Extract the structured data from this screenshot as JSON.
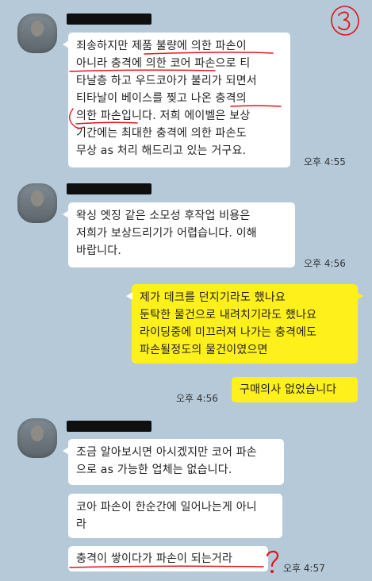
{
  "messages": [
    {
      "sender": "other",
      "lines": [
        "죄송하지만 제품 불량에 의한 파손이",
        "아니라 충격에 의한 코어 파손으로 티",
        "타날층 하고 우드코아가 불리가 되면서",
        " 티타날이 베이스를 찢고 나온 충격의",
        "의한 파손입니다. 저희 에이벨은 보상",
        "기간에는 최대한 충격에 의한 파손도",
        "무상 as 처리 해드리고 있는 거구요."
      ],
      "time": "오후 4:55"
    },
    {
      "sender": "other",
      "lines": [
        "왁싱 엣징 같은 소모성 후작업 비용은",
        "저희가 보상드리기가 어렵습니다. 이해",
        " 바랍니다."
      ],
      "time": "오후 4:56"
    },
    {
      "sender": "me",
      "lines": [
        "제가 데크를 던지기라도 했나요",
        "둔탁한 물건으로 내려치기라도 했나요",
        "라이딩중에 미끄러져 나가는 충격에도",
        "파손될정도의 물건이였으면"
      ]
    },
    {
      "sender": "me",
      "lines": [
        "구매의사 없었습니다"
      ],
      "time": "오후 4:56"
    },
    {
      "sender": "other",
      "lines": [
        "조금 알아보시면 아시겠지만 코어 파손",
        "으로 as 가능한 업체는 없습니다."
      ]
    },
    {
      "sender": "other",
      "lines": [
        "코아 파손이 한순간에 일어나는게 아니",
        "라"
      ]
    },
    {
      "sender": "other",
      "lines": [
        "충격이 쌓이다가 파손이 되는거라"
      ],
      "time": "오후 4:57"
    }
  ],
  "annotations": {
    "page_marker": "③",
    "question_mark": "?",
    "pen_color": "#e0141c"
  }
}
